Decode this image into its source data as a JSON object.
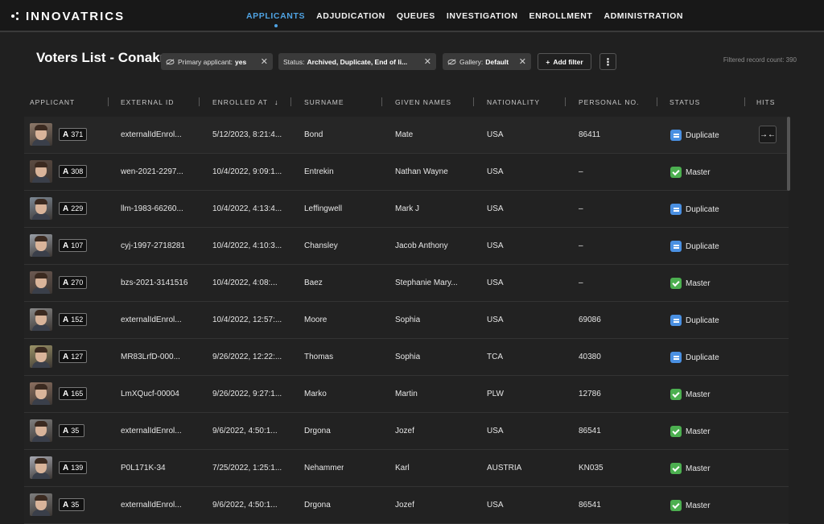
{
  "brand": {
    "name": "INNOVATRICS"
  },
  "nav": [
    {
      "label": "APPLICANTS",
      "active": true
    },
    {
      "label": "ADJUDICATION"
    },
    {
      "label": "QUEUES"
    },
    {
      "label": "INVESTIGATION"
    },
    {
      "label": "ENROLLMENT"
    },
    {
      "label": "ADMINISTRATION"
    }
  ],
  "toolbar": {
    "list_title": "Voters List - Conakry",
    "filters": [
      {
        "key": "Primary applicant:",
        "value": "yes"
      },
      {
        "key": "Status:",
        "value": "Archived, Duplicate, End of li..."
      },
      {
        "key": "Gallery:",
        "value": "Default"
      }
    ],
    "add_filter_label": "Add filter",
    "more_label": "⋮",
    "record_count": "Filtered record count: 390"
  },
  "table": {
    "columns": [
      "APPLICANT",
      "EXTERNAL ID",
      "ENROLLED AT",
      "SURNAME",
      "GIVEN NAMES",
      "NATIONALITY",
      "PERSONAL NO.",
      "STATUS",
      "HITS"
    ],
    "sort_indicator": "↓",
    "rows": [
      {
        "badge_letter": "A",
        "badge_num": "371",
        "external_id": "externalIdEnrol...",
        "enrolled_at": "5/12/2023, 8:21:4...",
        "surname": "Bond",
        "given_names": "Mate",
        "nationality": "USA",
        "personal_no": "86411",
        "status": "Duplicate",
        "hits": "→←"
      },
      {
        "badge_letter": "A",
        "badge_num": "308",
        "external_id": "wen-2021-2297...",
        "enrolled_at": "10/4/2022, 9:09:1...",
        "surname": "Entrekin",
        "given_names": "Nathan Wayne",
        "nationality": "USA",
        "personal_no": "–",
        "status": "Master"
      },
      {
        "badge_letter": "A",
        "badge_num": "229",
        "external_id": "llm-1983-66260...",
        "enrolled_at": "10/4/2022, 4:13:4...",
        "surname": "Leffingwell",
        "given_names": "Mark J",
        "nationality": "USA",
        "personal_no": "–",
        "status": "Duplicate"
      },
      {
        "badge_letter": "A",
        "badge_num": "107",
        "external_id": "cyj-1997-2718281",
        "enrolled_at": "10/4/2022, 4:10:3...",
        "surname": "Chansley",
        "given_names": "Jacob Anthony",
        "nationality": "USA",
        "personal_no": "–",
        "status": "Duplicate"
      },
      {
        "badge_letter": "A",
        "badge_num": "270",
        "external_id": "bzs-2021-3141516",
        "enrolled_at": "10/4/2022, 4:08:...",
        "surname": "Baez",
        "given_names": "Stephanie Mary...",
        "nationality": "USA",
        "personal_no": "–",
        "status": "Master"
      },
      {
        "badge_letter": "A",
        "badge_num": "152",
        "external_id": "externalIdEnrol...",
        "enrolled_at": "10/4/2022, 12:57:...",
        "surname": "Moore",
        "given_names": "Sophia",
        "nationality": "USA",
        "personal_no": "69086",
        "status": "Duplicate"
      },
      {
        "badge_letter": "A",
        "badge_num": "127",
        "external_id": "MR83LrfD-000...",
        "enrolled_at": "9/26/2022, 12:22:...",
        "surname": "Thomas",
        "given_names": "Sophia",
        "nationality": "TCA",
        "personal_no": "40380",
        "status": "Duplicate"
      },
      {
        "badge_letter": "A",
        "badge_num": "165",
        "external_id": "LmXQucf-00004",
        "enrolled_at": "9/26/2022, 9:27:1...",
        "surname": "Marko",
        "given_names": "Martin",
        "nationality": "PLW",
        "personal_no": "12786",
        "status": "Master"
      },
      {
        "badge_letter": "A",
        "badge_num": "35",
        "external_id": "externalIdEnrol...",
        "enrolled_at": "9/6/2022, 4:50:1...",
        "surname": "Drgona",
        "given_names": "Jozef",
        "nationality": "USA",
        "personal_no": "86541",
        "status": "Master"
      },
      {
        "badge_letter": "A",
        "badge_num": "139",
        "external_id": "P0L171K-34",
        "enrolled_at": "7/25/2022, 1:25:1...",
        "surname": "Nehammer",
        "given_names": "Karl",
        "nationality": "AUSTRIA",
        "personal_no": "KN035",
        "status": "Master"
      },
      {
        "badge_letter": "A",
        "badge_num": "35",
        "external_id": "externalIdEnrol...",
        "enrolled_at": "9/6/2022, 4:50:1...",
        "surname": "Drgona",
        "given_names": "Jozef",
        "nationality": "USA",
        "personal_no": "86541",
        "status": "Master"
      }
    ]
  },
  "colors": {
    "accent": "#4fa3e3",
    "duplicate": "#4a90e2",
    "master": "#4caf50"
  }
}
